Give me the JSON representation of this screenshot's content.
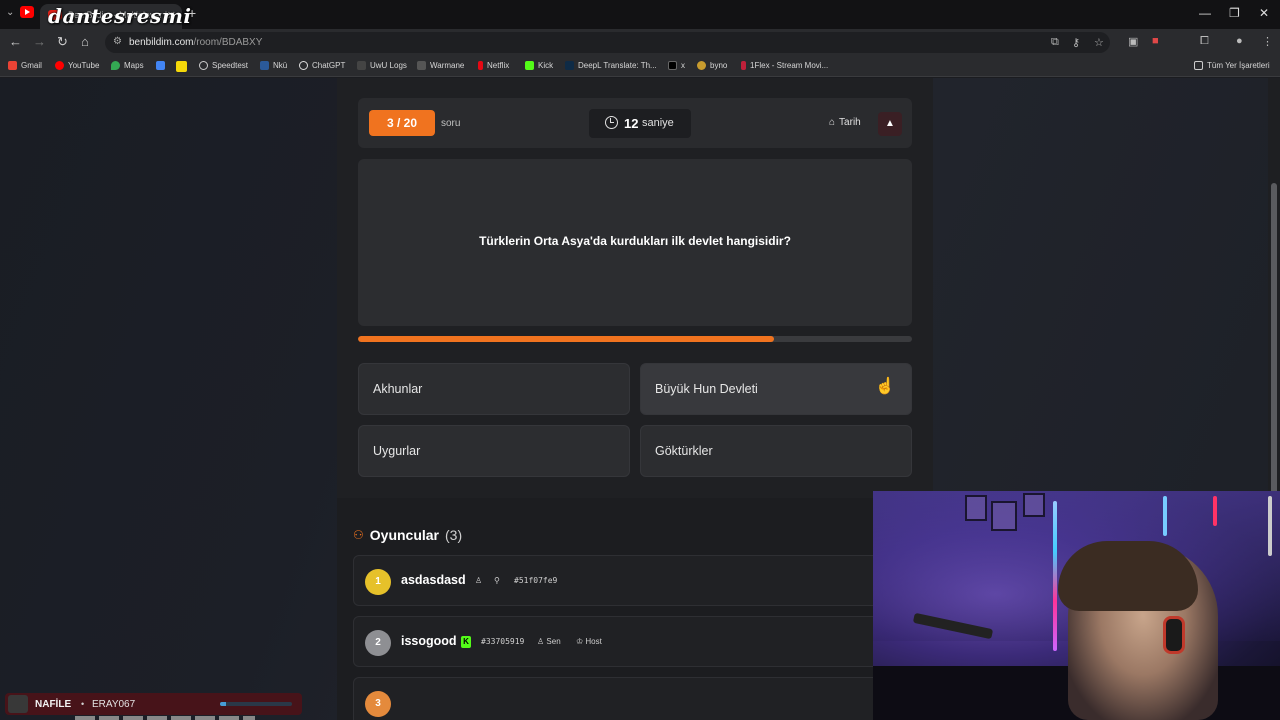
{
  "browser": {
    "tab_title": "Ben Bildim - Multiplayer bilgi Oyunu",
    "watermark": "dantesresmi",
    "url_host": "benbildim.com",
    "url_path": "/room/BDABXY",
    "bookmarks": [
      "Gmail",
      "YouTube",
      "Maps",
      "",
      "",
      "Speedtest",
      "Nkü",
      "ChatGPT",
      "UwU Logs",
      "Warmane",
      "Netflix",
      "Kick",
      "DeepL Translate: Th...",
      "x",
      "byno",
      "1Flex - Stream Movi..."
    ],
    "all_bookmarks": "Tüm Yer İşaretleri",
    "colors": {
      "accent": "#f0731f",
      "kick": "#53fc18"
    }
  },
  "quiz": {
    "question_counter": "3 / 20",
    "question_word": "soru",
    "timer_value": "12",
    "timer_unit": "saniye",
    "category": "Tarih",
    "question": "Türklerin Orta Asya'da kurdukları ilk devlet hangisidir?",
    "progress": 0.75,
    "answers": [
      "Akhunlar",
      "Büyük Hun Devleti",
      "Uygurlar",
      "Göktürkler"
    ]
  },
  "players": {
    "title": "Oyuncular",
    "count": "(3)",
    "list": [
      {
        "rank": "1",
        "name": "asdasdasd",
        "id": "#51f07fe9",
        "you": "",
        "host": ""
      },
      {
        "rank": "2",
        "name": "issogood",
        "id": "#33705919",
        "you": "Sen",
        "host": "Host"
      },
      {
        "rank": "3",
        "name": "",
        "id": "",
        "you": "",
        "host": ""
      }
    ]
  },
  "stream_widget": {
    "name": "NAFİLE",
    "separator": "•",
    "user": "ERAY067",
    "progress": 0.08
  }
}
